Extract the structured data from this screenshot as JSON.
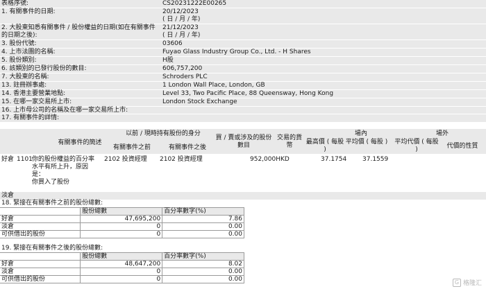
{
  "rows": [
    {
      "label": "表格序號:",
      "value": "CS20231222E00265"
    },
    {
      "label": "1. 有關事件的日期:",
      "value": "20/12/2023",
      "sub": "( 日 / 月 / 年)"
    },
    {
      "label": "2. 大股東知悉有關事件 / 股份權益的日期(如在有關事件的日期之後):",
      "value": "21/12/2023",
      "sub": "( 日 / 月 / 年)"
    },
    {
      "label": "3. 股份代號:",
      "value": "03606"
    },
    {
      "label": "4. 上市法團的名稱:",
      "value": "Fuyao Glass Industry Group Co., Ltd. - H Shares"
    },
    {
      "label": "5. 股份類別:",
      "value": "H股"
    },
    {
      "label": "6. 該類別的已發行股份的數目:",
      "value": "606,757,200"
    },
    {
      "label": "7. 大股東的名稱:",
      "value": "Schroders PLC"
    },
    {
      "label": "13. 註冊辦事處:",
      "value": "1 London Wall Place, London, GB"
    },
    {
      "label": "14. 香港主要營業地點:",
      "value": "Level 33, Two Pacific Place, 88 Queensway, Hong Kong"
    },
    {
      "label": "15. 在哪一家交易所上市:",
      "value": "London Stock Exchange"
    }
  ],
  "row16": "16. 上市母公司的名稱及在哪一家交易所上市:",
  "row17": "17. 有關事件的詳情:",
  "event": {
    "h_desc": "有關事件的簡述",
    "h_capacity": "以前 / 現時持有股份的身分",
    "h_before": "有關事件之前",
    "h_after": "有關事件之後",
    "h_shares": "買 / 賣或涉及的股份數目",
    "h_currency": "交易的貨幣",
    "h_onex": "場內",
    "h_offex": "場外",
    "h_high": "最高價 ( 每股 )",
    "h_avg": "平均價 ( 每股 )",
    "h_avg2": "平均代價 ( 每股 )",
    "h_consid": "代價的性質",
    "position": "好倉",
    "code": "1101",
    "desc": "你的股份權益的百分率水平有所上升，原因是：你買入了股份",
    "desc_lines": [
      "你的股份權益的百分率",
      "水平有所上升，原因",
      "是：",
      "你買入了股份"
    ],
    "before": "2102 投資經理",
    "after": "2102 投資經理",
    "shares": "952,000HKD",
    "high": "37.1754",
    "avg": "37.1559"
  },
  "short_label": "淡倉",
  "sec18": {
    "title": "18. 緊接在有關事件之前的股份總數:",
    "col_shares": "股份總數",
    "col_pct": "百分率數字(%)",
    "rows": [
      {
        "label": "好倉",
        "shares": "47,695,200",
        "pct": "7.86"
      },
      {
        "label": "淡倉",
        "shares": "0",
        "pct": "0.00"
      },
      {
        "label": "可供借出的股份",
        "shares": "0",
        "pct": "0.00"
      }
    ]
  },
  "sec19": {
    "title": "19. 緊接在有關事件之後的股份總數:",
    "col_shares": "股份總數",
    "col_pct": "百分率數字(%)",
    "rows": [
      {
        "label": "好倉",
        "shares": "48,647,200",
        "pct": "8.02"
      },
      {
        "label": "淡倉",
        "shares": "0",
        "pct": "0.00"
      },
      {
        "label": "可供借出的股份",
        "shares": "0",
        "pct": "0.00"
      }
    ]
  },
  "watermark": "格隆汇"
}
